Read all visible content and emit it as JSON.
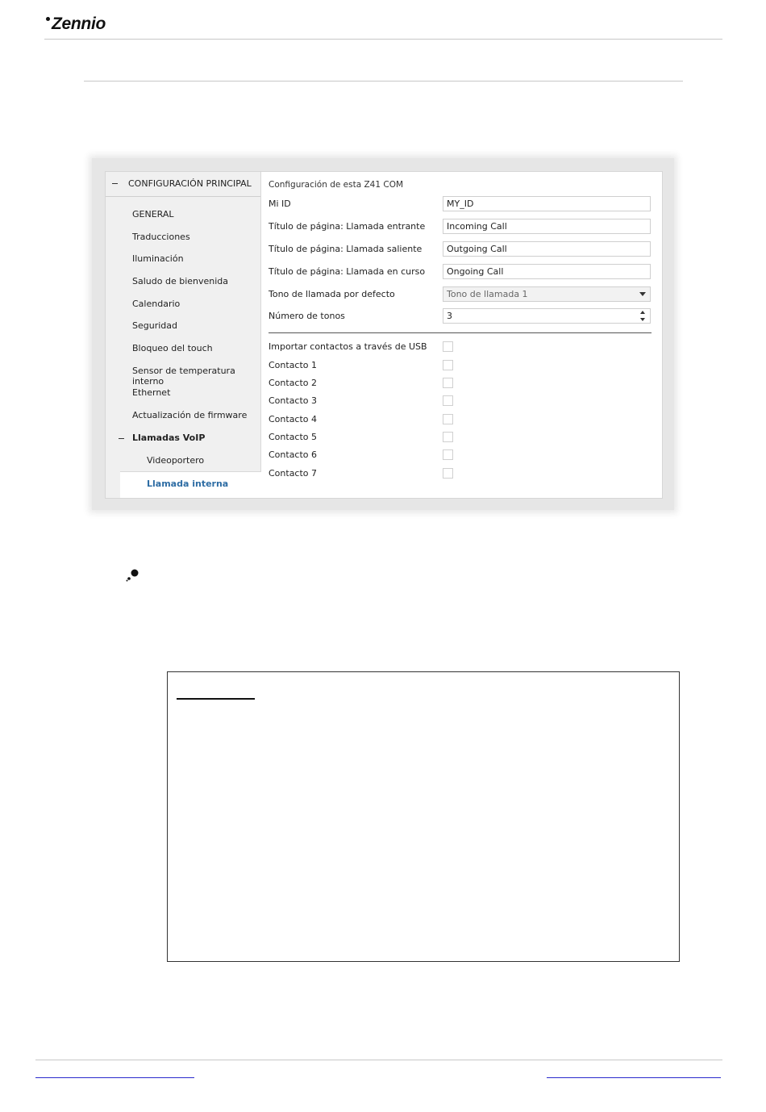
{
  "header": {
    "logo": "Zennio"
  },
  "screenshot": {
    "sidebar": {
      "root": "CONFIGURACIÓN PRINCIPAL",
      "items": [
        "GENERAL",
        "Traducciones",
        "Iluminación",
        "Saludo de bienvenida",
        "Calendario",
        "Seguridad",
        "Bloqueo del touch",
        "Sensor de temperatura interno",
        "Ethernet",
        "Actualización de firmware"
      ],
      "group": "Llamadas VoIP",
      "subitems": [
        "Videoportero"
      ],
      "selected": "Llamada interna"
    },
    "panel": {
      "title": "Configuración de esta Z41 COM",
      "rows": [
        {
          "label": "Mi ID",
          "value": "MY_ID",
          "type": "text"
        },
        {
          "label": "Título de página: Llamada entrante",
          "value": "Incoming Call",
          "type": "text"
        },
        {
          "label": "Título de página: Llamada saliente",
          "value": "Outgoing Call",
          "type": "text"
        },
        {
          "label": "Título de página: Llamada en curso",
          "value": "Ongoing Call",
          "type": "text"
        },
        {
          "label": "Tono de llamada por defecto",
          "value": "Tono de llamada 1",
          "type": "select"
        },
        {
          "label": "Número de tonos",
          "value": "3",
          "type": "spin"
        }
      ],
      "checks": [
        "Importar contactos a través de USB",
        "Contacto 1",
        "Contacto 2",
        "Contacto 3",
        "Contacto 4",
        "Contacto 5",
        "Contacto 6",
        "Contacto 7"
      ]
    }
  }
}
